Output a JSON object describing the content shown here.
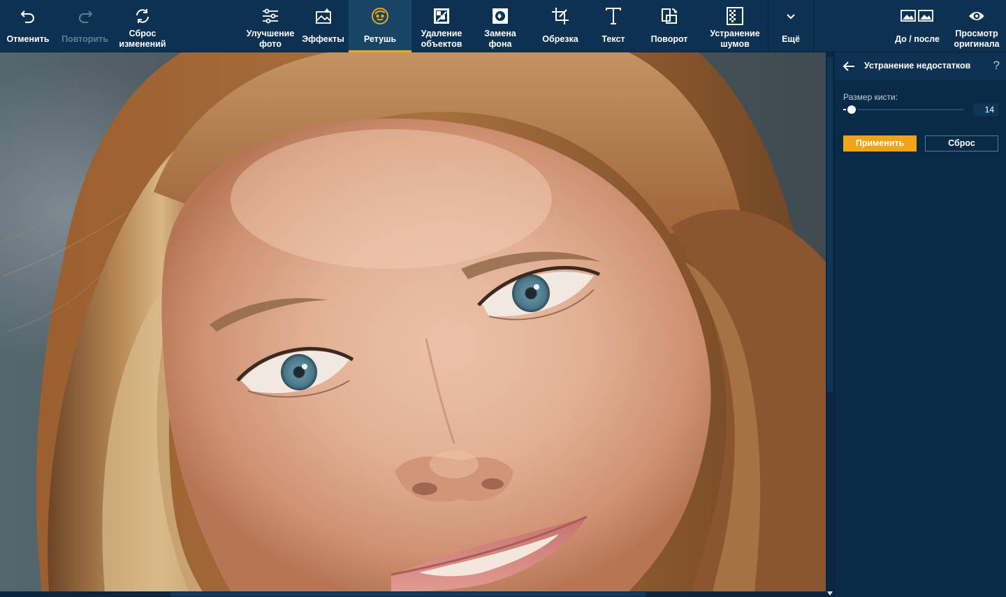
{
  "toolbar": {
    "undo": "Отменить",
    "redo": "Повторить",
    "reset_line1": "Сброс",
    "reset_line2": "изменений",
    "enhance_line1": "Улучшение",
    "enhance_line2": "фото",
    "effects": "Эффекты",
    "retouch": "Ретушь",
    "remove_line1": "Удаление",
    "remove_line2": "объектов",
    "bg_line1": "Замена",
    "bg_line2": "фона",
    "crop": "Обрезка",
    "text": "Текст",
    "rotate": "Поворот",
    "denoise_line1": "Устранение",
    "denoise_line2": "шумов",
    "more": "Ещё",
    "before_after": "До / после",
    "preview_line1": "Просмотр",
    "preview_line2": "оригинала",
    "active_tool": "Ретушь"
  },
  "icons": {
    "undo": "undo-icon",
    "redo": "redo-icon",
    "reset": "refresh-icon",
    "enhance": "sliders-icon",
    "effects": "magic-image-icon",
    "retouch": "face-icon",
    "remove": "stamp-icon",
    "bg": "background-replace-icon",
    "crop": "crop-icon",
    "text": "text-icon",
    "rotate": "rotate-icon",
    "denoise": "noise-icon",
    "more": "chevron-down-icon",
    "before_after": "before-after-icon",
    "preview": "eye-icon"
  },
  "panel": {
    "title": "Устранение недостатков",
    "help": "?",
    "brush_label": "Размер кисти:",
    "brush_value": "14",
    "brush_fraction": 0.07,
    "apply_label": "Применить",
    "reset_label": "Сброс"
  },
  "colors": {
    "toolbar_bg": "#0d3150",
    "panel_bg": "#0a2b47",
    "accent": "#f0a418",
    "disabled_text": "#5f7d97"
  }
}
